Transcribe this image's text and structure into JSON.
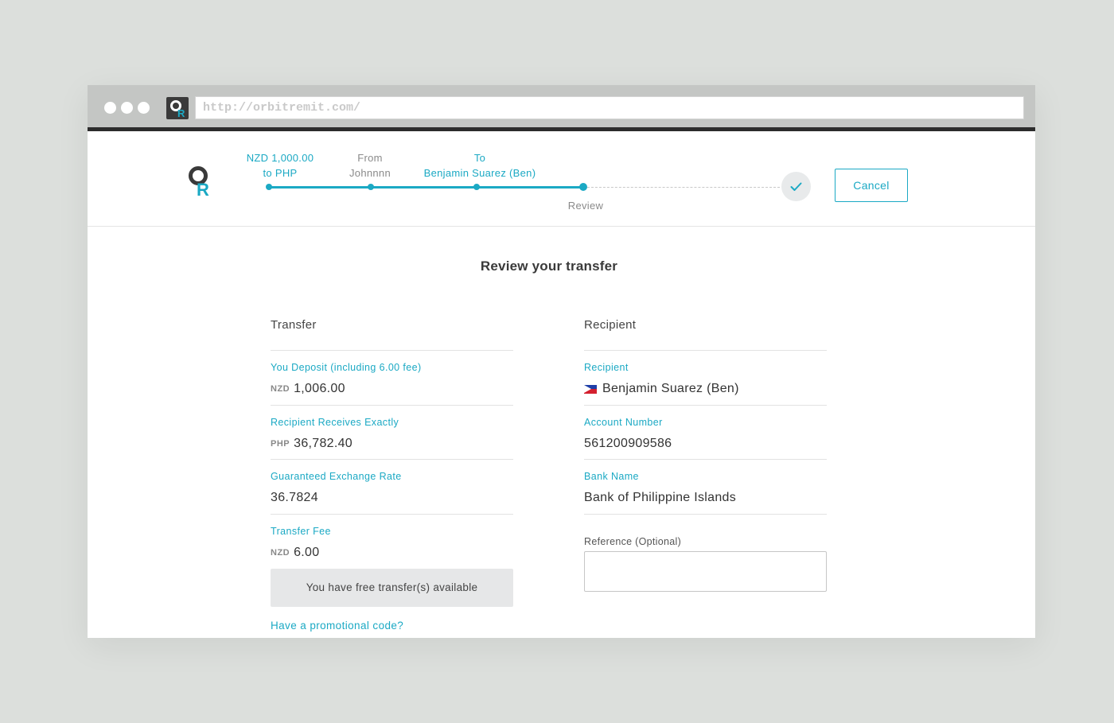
{
  "browser": {
    "url": "http://orbitremit.com/"
  },
  "progress": {
    "steps": [
      {
        "line1": "NZD 1,000.00",
        "line2": "to PHP",
        "status": "done"
      },
      {
        "line1": "From",
        "line2": "Johnnnn",
        "status": "done"
      },
      {
        "line1": "To",
        "line2": "Benjamin Suarez (Ben)",
        "status": "done"
      },
      {
        "line1": "Review",
        "status": "current"
      }
    ],
    "cancel_label": "Cancel"
  },
  "page": {
    "title": "Review your transfer"
  },
  "transfer": {
    "heading": "Transfer",
    "fields": [
      {
        "label": "You Deposit (including 6.00 fee)",
        "currency": "NZD",
        "value": "1,006.00"
      },
      {
        "label": "Recipient Receives Exactly",
        "currency": "PHP",
        "value": "36,782.40"
      },
      {
        "label": "Guaranteed Exchange Rate",
        "currency": "",
        "value": "36.7824"
      },
      {
        "label": "Transfer Fee",
        "currency": "NZD",
        "value": "6.00"
      }
    ],
    "free_notice": "You have free transfer(s) available",
    "promo_link": "Have a promotional code?"
  },
  "recipient": {
    "heading": "Recipient",
    "fields": [
      {
        "label": "Recipient",
        "value": "Benjamin Suarez (Ben)",
        "flag": "philippines-flag"
      },
      {
        "label": "Account Number",
        "value": "561200909586"
      },
      {
        "label": "Bank Name",
        "value": "Bank of Philippine Islands"
      }
    ],
    "reference_label": "Reference (Optional)",
    "reference_value": ""
  },
  "colors": {
    "accent": "#1ba9c4",
    "background": "#dcdfdc",
    "chrome": "#c4c6c4"
  }
}
